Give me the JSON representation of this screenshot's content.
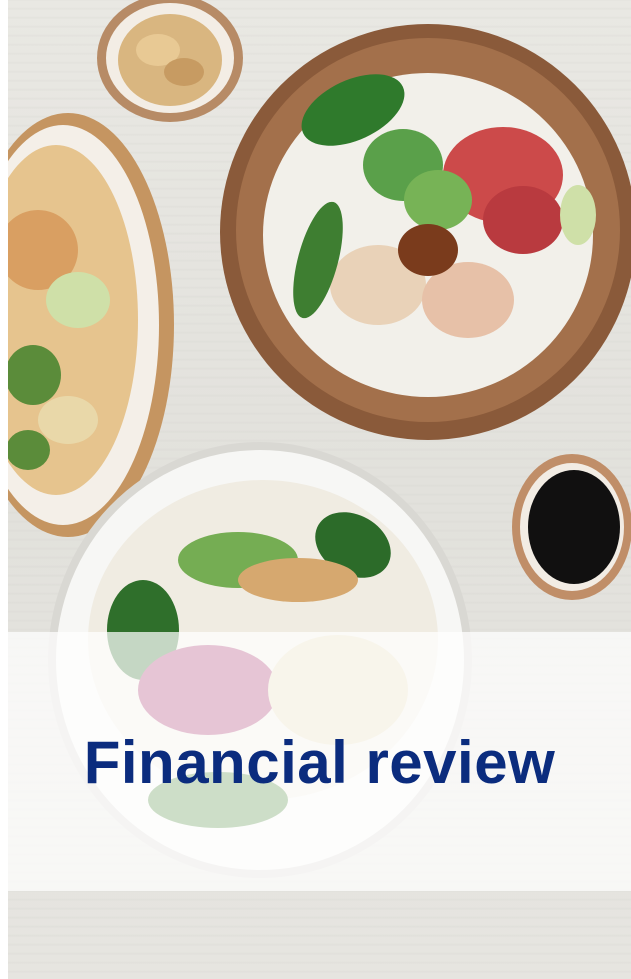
{
  "cover": {
    "title": "Financial review"
  },
  "colors": {
    "title": "#0b2c7e",
    "wood_bowl": "#8a5a3a",
    "backdrop": "#e6e5e0"
  }
}
